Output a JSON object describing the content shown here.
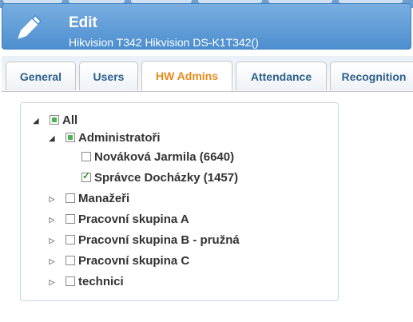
{
  "header": {
    "title": "Edit",
    "subtitle": "Hikvision T342 Hikvision DS-K1T342()",
    "icon": "pencil-icon"
  },
  "tabs": [
    {
      "label": "General",
      "active": false
    },
    {
      "label": "Users",
      "active": false
    },
    {
      "label": "HW Admins",
      "active": true
    },
    {
      "label": "Attendance",
      "active": false
    },
    {
      "label": "Recognition",
      "active": false
    }
  ],
  "tree": {
    "root": {
      "label": "All",
      "state": "partial",
      "expanded": true
    },
    "groups": [
      {
        "label": "Administratoři",
        "state": "partial",
        "expanded": true,
        "children": [
          {
            "label": "Nováková Jarmila (6640)",
            "state": "unchecked"
          },
          {
            "label": "Správce Docházky (1457)",
            "state": "checked"
          }
        ]
      },
      {
        "label": "Manažeři",
        "state": "unchecked",
        "expanded": false
      },
      {
        "label": "Pracovní skupina A",
        "state": "unchecked",
        "expanded": false
      },
      {
        "label": "Pracovní skupina B - pružná",
        "state": "unchecked",
        "expanded": false
      },
      {
        "label": "Pracovní skupina C",
        "state": "unchecked",
        "expanded": false
      },
      {
        "label": "technici",
        "state": "unchecked",
        "expanded": false
      }
    ]
  },
  "colors": {
    "accent": "#4d8fcf",
    "active_tab": "#e58a20",
    "check": "#4cb54c"
  }
}
